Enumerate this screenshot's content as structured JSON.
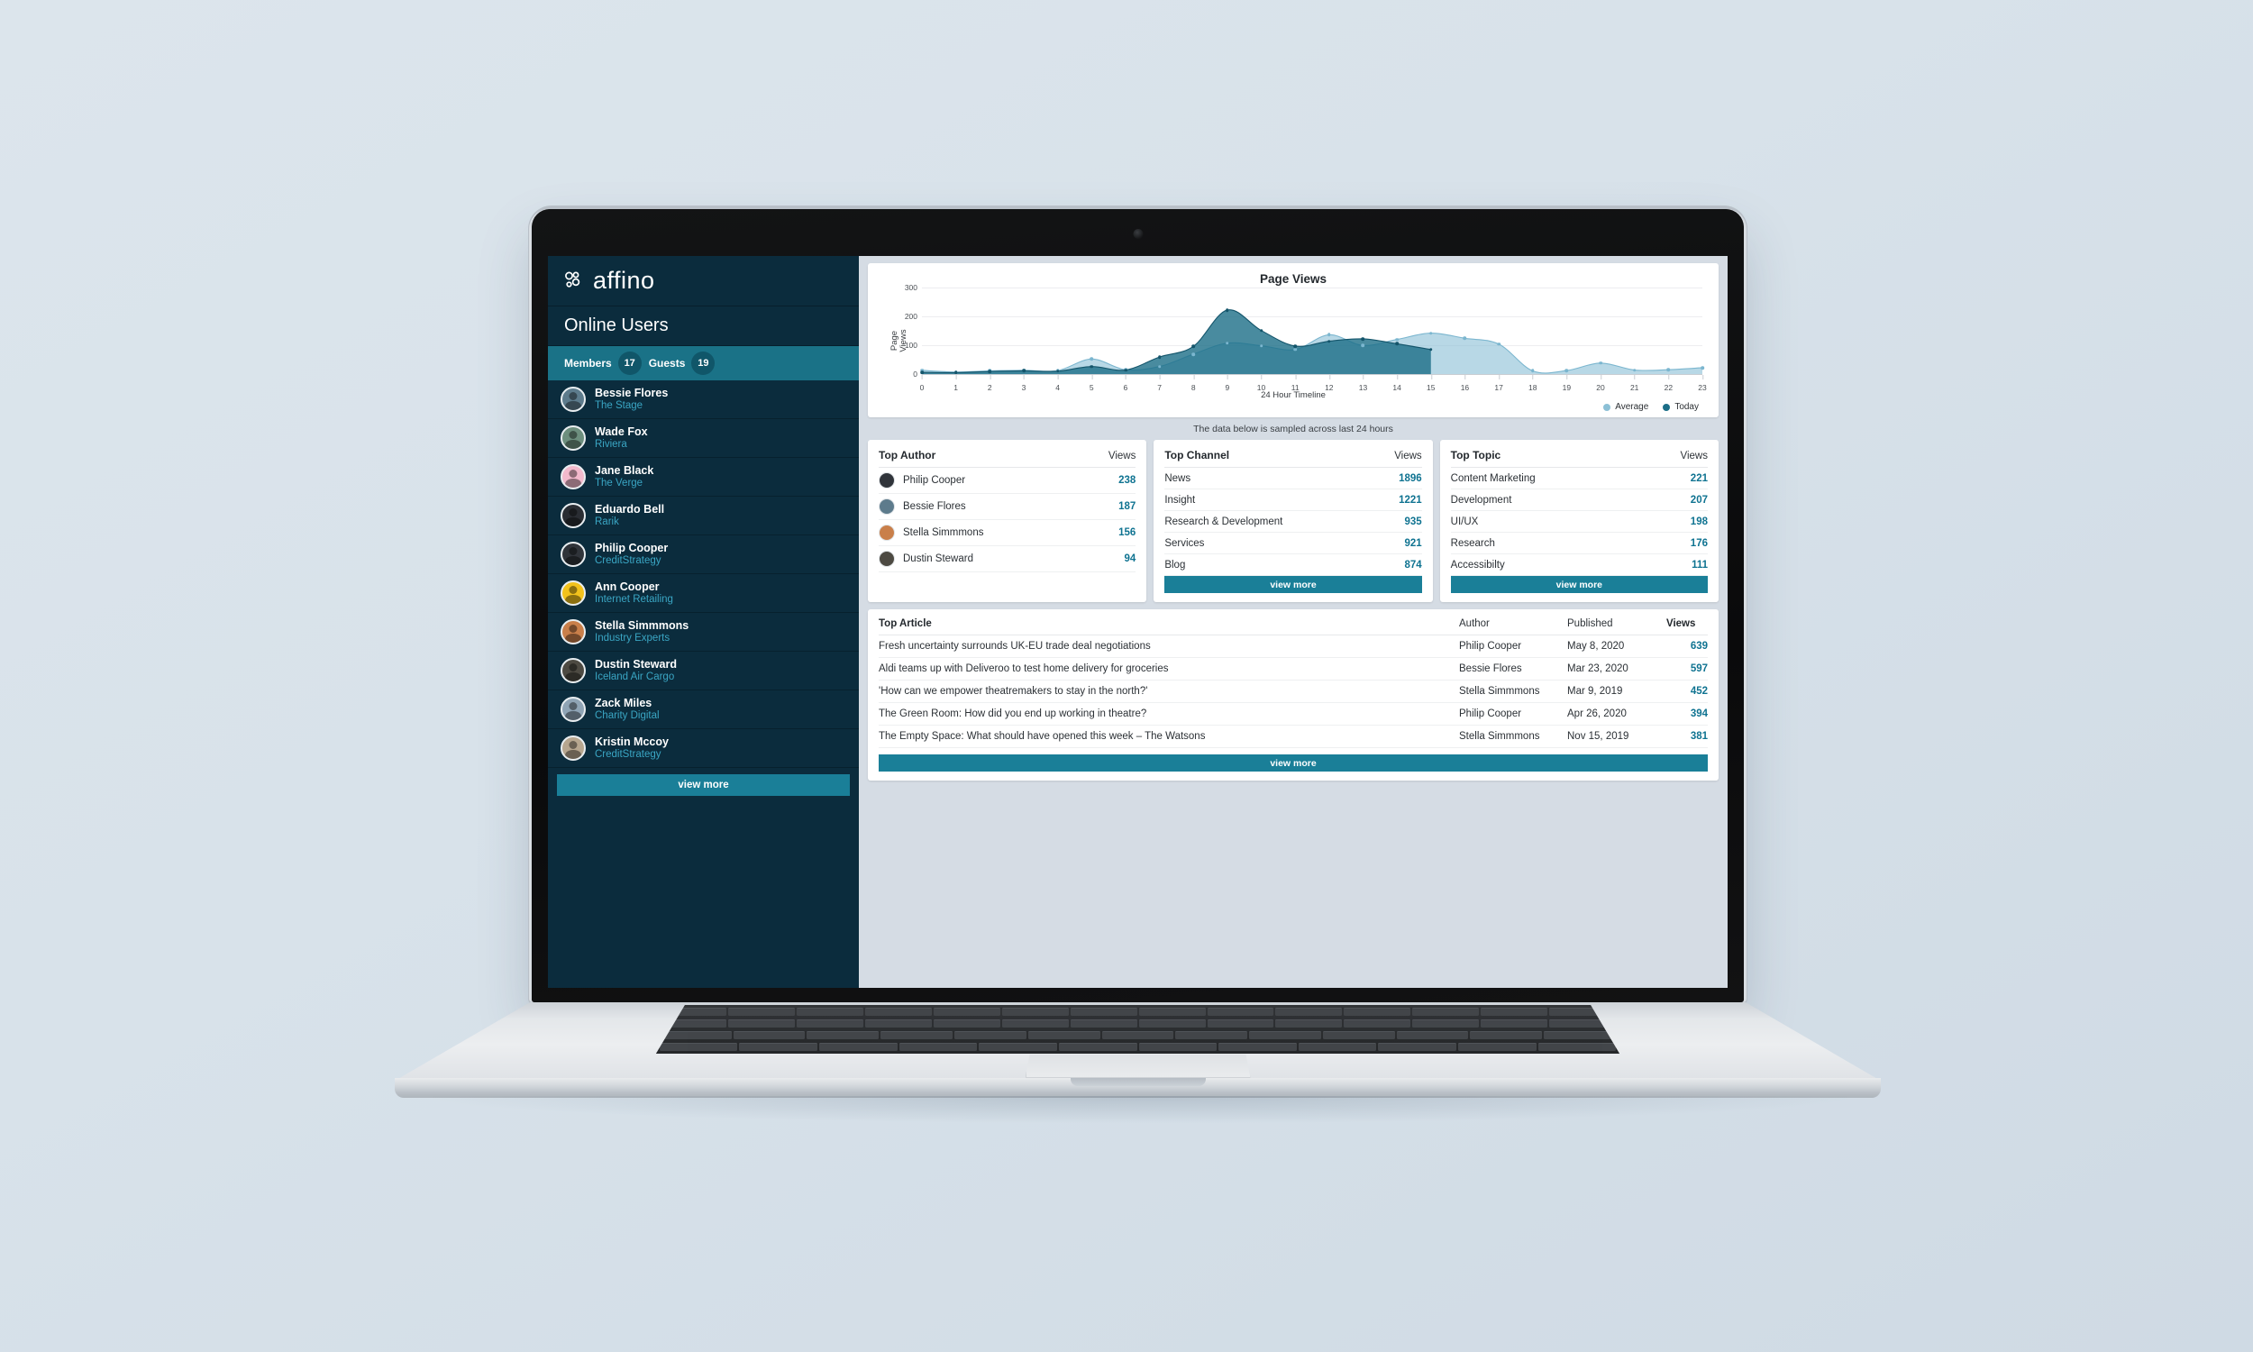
{
  "sidebar": {
    "logo_text": "affino",
    "logo_icon": "affino-circles-logo",
    "section_title": "Online Users",
    "tabs": [
      {
        "label": "Members",
        "count": "17"
      },
      {
        "label": "Guests",
        "count": "19"
      }
    ],
    "users": [
      {
        "name": "Bessie Flores",
        "org": "The Stage",
        "avatar_bg": "#5d7b8c"
      },
      {
        "name": "Wade Fox",
        "org": "Riviera",
        "avatar_bg": "#6d8f7e"
      },
      {
        "name": "Jane Black",
        "org": "The Verge",
        "avatar_bg": "#f2b9cc"
      },
      {
        "name": "Eduardo Bell",
        "org": "Rarik",
        "avatar_bg": "#2a2d33"
      },
      {
        "name": "Philip Cooper",
        "org": "CreditStrategy",
        "avatar_bg": "#30343a"
      },
      {
        "name": "Ann Cooper",
        "org": "Internet Retailing",
        "avatar_bg": "#f2c21c"
      },
      {
        "name": "Stella Simmmons",
        "org": "Industry Experts",
        "avatar_bg": "#c97f4a"
      },
      {
        "name": "Dustin Steward",
        "org": "Iceland Air Cargo",
        "avatar_bg": "#4d4a42"
      },
      {
        "name": "Zack Miles",
        "org": "Charity Digital",
        "avatar_bg": "#8fa4b5"
      },
      {
        "name": "Kristin Mccoy",
        "org": "CreditStrategy",
        "avatar_bg": "#b7a68f"
      }
    ],
    "view_more_label": "view more"
  },
  "chart_data": {
    "type": "area",
    "title": "Page Views",
    "xlabel": "24 Hour Timeline",
    "ylabel": "Page Views",
    "ylim": [
      0,
      300
    ],
    "yticks": [
      0,
      100,
      200,
      300
    ],
    "grid": true,
    "legend_position": "bottom-right",
    "x": [
      0,
      1,
      2,
      3,
      4,
      5,
      6,
      7,
      8,
      9,
      10,
      11,
      12,
      13,
      14,
      15,
      16,
      17,
      18,
      19,
      20,
      21,
      22,
      23
    ],
    "series": [
      {
        "name": "Average",
        "color": "#8cc0d6",
        "values": [
          13,
          7,
          11,
          13,
          12,
          52,
          15,
          26,
          69,
          107,
          98,
          85,
          136,
          99,
          120,
          142,
          124,
          104,
          11,
          12,
          38,
          14,
          15,
          22
        ]
      },
      {
        "name": "Today",
        "color": "#1b6e87",
        "values": [
          6,
          5,
          9,
          11,
          10,
          26,
          14,
          59,
          96,
          222,
          151,
          97,
          114,
          122,
          105,
          85,
          null,
          null,
          null,
          null,
          null,
          null,
          null,
          null
        ]
      }
    ]
  },
  "sample_note": "The data below is sampled across last 24 hours",
  "top_author": {
    "title": "Top Author",
    "views_header": "Views",
    "rows": [
      {
        "name": "Philip Cooper",
        "views": "238",
        "avatar_bg": "#30343a"
      },
      {
        "name": "Bessie Flores",
        "views": "187",
        "avatar_bg": "#5d7b8c"
      },
      {
        "name": "Stella Simmmons",
        "views": "156",
        "avatar_bg": "#c97f4a"
      },
      {
        "name": "Dustin Steward",
        "views": "94",
        "avatar_bg": "#4d4a42"
      }
    ]
  },
  "top_channel": {
    "title": "Top Channel",
    "views_header": "Views",
    "rows": [
      {
        "name": "News",
        "views": "1896"
      },
      {
        "name": "Insight",
        "views": "1221"
      },
      {
        "name": "Research & Development",
        "views": "935"
      },
      {
        "name": "Services",
        "views": "921"
      },
      {
        "name": "Blog",
        "views": "874"
      }
    ],
    "view_more_label": "view more"
  },
  "top_topic": {
    "title": "Top Topic",
    "views_header": "Views",
    "rows": [
      {
        "name": "Content Marketing",
        "views": "221"
      },
      {
        "name": "Development",
        "views": "207"
      },
      {
        "name": "UI/UX",
        "views": "198"
      },
      {
        "name": "Research",
        "views": "176"
      },
      {
        "name": "Accessibilty",
        "views": "111"
      }
    ],
    "view_more_label": "view more"
  },
  "top_article": {
    "title": "Top Article",
    "col_author": "Author",
    "col_published": "Published",
    "col_views": "Views",
    "rows": [
      {
        "title": "Fresh uncertainty surrounds UK-EU trade deal negotiations",
        "author": "Philip Cooper",
        "published": "May 8, 2020",
        "views": "639"
      },
      {
        "title": "Aldi teams up with Deliveroo to test home delivery for groceries",
        "author": "Bessie Flores",
        "published": "Mar 23, 2020",
        "views": "597"
      },
      {
        "title": "'How can we empower theatremakers to stay in the north?'",
        "author": "Stella Simmmons",
        "published": "Mar 9, 2019",
        "views": "452"
      },
      {
        "title": "The Green Room: How did you end up working in theatre?",
        "author": "Philip Cooper",
        "published": "Apr 26, 2020",
        "views": "394"
      },
      {
        "title": "The Empty Space: What should have opened this week – The Watsons",
        "author": "Stella Simmmons",
        "published": "Nov 15, 2019",
        "views": "381"
      }
    ],
    "view_more_label": "view more"
  },
  "theme": {
    "sidebar_bg": "#0b2c3d",
    "accent": "#1a7f98",
    "tabbar": "#1a7287",
    "page_bg": "#d5dce4",
    "value_color": "#0f7391"
  }
}
